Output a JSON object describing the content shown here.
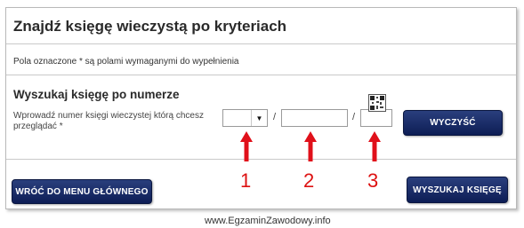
{
  "page": {
    "title": "Znajdź księgę wieczystą po kryteriach",
    "required_note": "Pola oznaczone * są polami wymaganymi do wypełnienia"
  },
  "search_by_number": {
    "section_title": "Wyszukaj księgę po numerze",
    "field_label": "Wprowadź numer księgi wieczystej którą chcesz przeglądać *",
    "court_code_select": {
      "value": ""
    },
    "separator": "/",
    "register_number_input": {
      "value": "",
      "placeholder": ""
    },
    "control_digit_input": {
      "value": "",
      "placeholder": ""
    },
    "clear_button_label": "WYCZYŚĆ"
  },
  "buttons": {
    "back_to_menu_label": "WRÓĆ DO MENU GŁÓWNEGO",
    "search_book_label": "WYSZUKAJ KSIĘGĘ"
  },
  "annotations": {
    "arrow_color": "#e0101a",
    "labels": [
      "1",
      "2",
      "3"
    ]
  },
  "footer": {
    "watermark": "www.EgzaminZawodowy.info"
  }
}
